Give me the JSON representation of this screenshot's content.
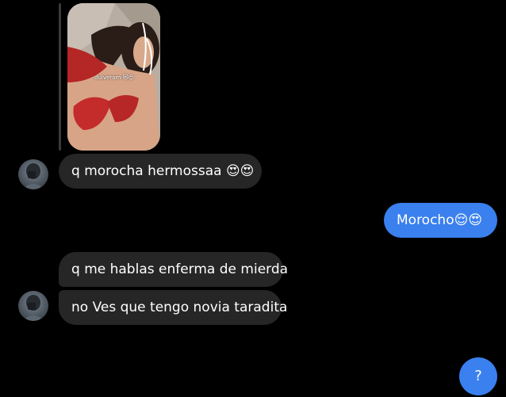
{
  "conversation": {
    "shared_photo": {
      "caption": "dulveram 😻😍"
    },
    "messages": [
      {
        "sender": "them",
        "text": "q morocha hermossaa 😍😍"
      },
      {
        "sender": "me",
        "text": "Morocho😌😍"
      },
      {
        "sender": "them",
        "text": "q me hablas enferma de mierda"
      },
      {
        "sender": "them",
        "text": "no Ves que tengo novia taradita"
      }
    ]
  },
  "help_button": {
    "label": "?"
  },
  "colors": {
    "background": "#000000",
    "incoming_bubble": "#262626",
    "outgoing_bubble": "#3a80ef",
    "text": "#ffffff"
  }
}
